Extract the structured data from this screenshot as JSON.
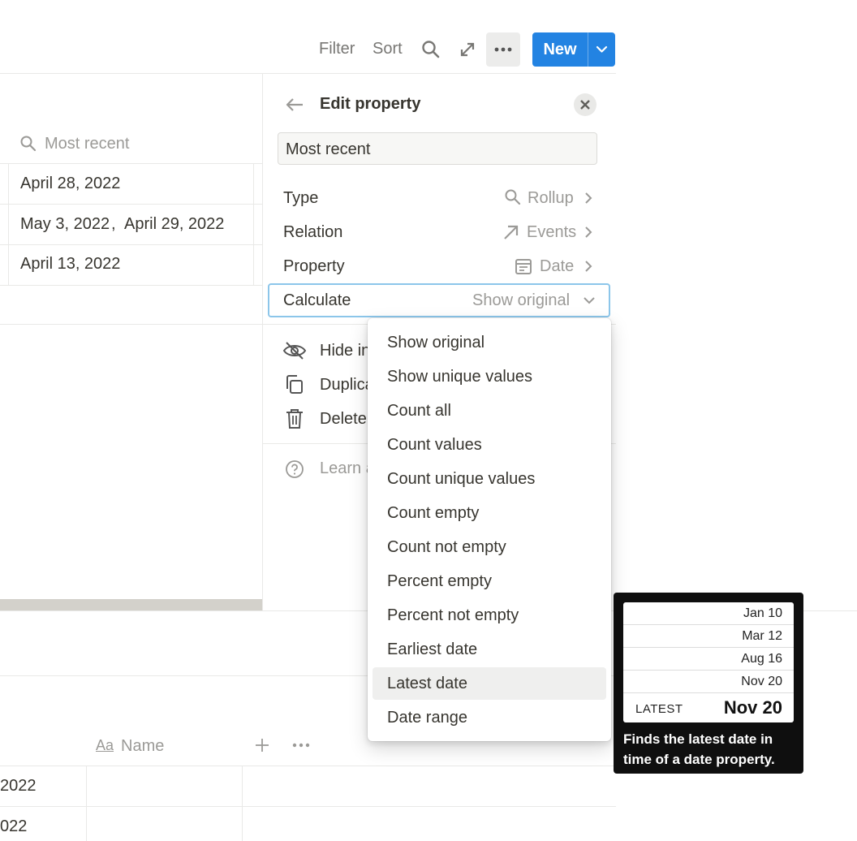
{
  "toolbar": {
    "filter_label": "Filter",
    "sort_label": "Sort",
    "search_icon": "search-icon",
    "expand_icon": "expand-icon",
    "more_icon": "more-icon",
    "new_label": "New",
    "accent": "#2383e2"
  },
  "table_top": {
    "column_header": "Most recent",
    "rows": [
      {
        "value_1": "April 28, 2022",
        "value_2": ""
      },
      {
        "value_1": "May 3, 2022",
        "value_2": "April 29, 2022"
      },
      {
        "value_1": "April 13, 2022",
        "value_2": ""
      }
    ]
  },
  "table_bottom": {
    "column_header": "Name",
    "column_icon": "Aa",
    "rows": [
      {
        "date_fragment": "2022"
      },
      {
        "date_fragment": "022"
      }
    ]
  },
  "edit_panel": {
    "title": "Edit property",
    "property_name_value": "Most recent",
    "type": {
      "label": "Type",
      "value": "Rollup"
    },
    "relation": {
      "label": "Relation",
      "value": "Events"
    },
    "property": {
      "label": "Property",
      "value": "Date"
    },
    "calculate": {
      "label": "Calculate",
      "value": "Show original"
    },
    "actions": {
      "hide": "Hide in view",
      "duplicate": "Duplicate property",
      "delete": "Delete property",
      "learn": "Learn about rollups"
    }
  },
  "calculate_menu": {
    "items": [
      "Show original",
      "Show unique values",
      "Count all",
      "Count values",
      "Count unique values",
      "Count empty",
      "Count not empty",
      "Percent empty",
      "Percent not empty",
      "Earliest date",
      "Latest date",
      "Date range"
    ],
    "hovered": "Latest date"
  },
  "tooltip": {
    "dates": [
      "Jan 10",
      "Mar 12",
      "Aug 16",
      "Nov 20"
    ],
    "latest_label": "LATEST",
    "latest_value": "Nov 20",
    "description": "Finds the latest date in time of a date property."
  }
}
